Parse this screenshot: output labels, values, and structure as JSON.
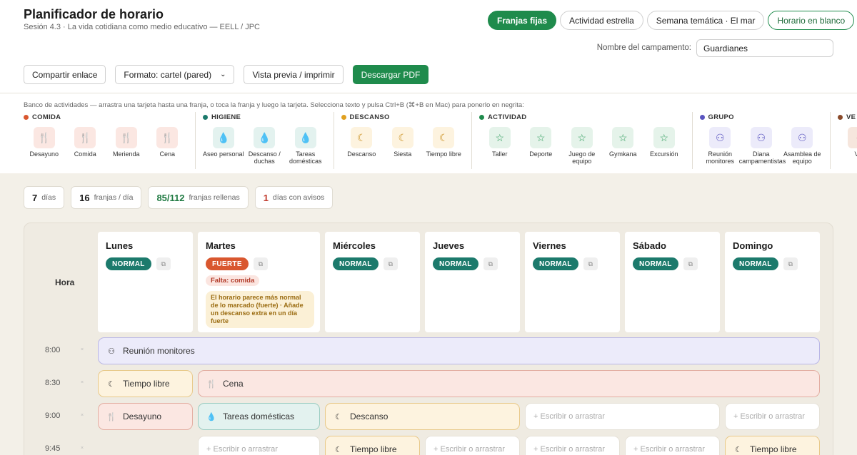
{
  "header": {
    "title": "Planificador de horario",
    "subtitle": "Sesión 4.3 · La vida cotidiana como medio educativo — EELL / JPC"
  },
  "mode_tabs": [
    {
      "label": "Franjas fijas",
      "active": true
    },
    {
      "label": "Actividad estrella",
      "active": false
    },
    {
      "label": "Semana temática · El mar",
      "active": false
    },
    {
      "label": "Horario en blanco",
      "active": false
    }
  ],
  "camp": {
    "label": "Nombre del campamento:",
    "value": "Guardianes"
  },
  "toolbar": {
    "share": "Compartir enlace",
    "format": "Formato: cartel (pared)",
    "preview": "Vista previa / imprimir",
    "download": "Descargar PDF"
  },
  "bank": {
    "hint": "Banco de actividades — arrastra una tarjeta hasta una franja, o toca la franja y luego la tarjeta. Selecciona texto y pulsa Ctrl+B (⌘+B en Mac) para ponerlo en negrita:",
    "categories": [
      {
        "name": "COMIDA",
        "color": "#d9572f",
        "bg": "#fbe7e2",
        "fg": "#c0533a",
        "icon": "utensils-icon",
        "glyph": "🍴",
        "items": [
          "Desayuno",
          "Comida",
          "Merienda",
          "Cena"
        ]
      },
      {
        "name": "HIGIENE",
        "color": "#1c7a6c",
        "bg": "#e3f2ef",
        "fg": "#2a8a7c",
        "icon": "droplet-icon",
        "glyph": "💧",
        "items": [
          "Aseo personal",
          "Descanso / duchas",
          "Tareas domésticas"
        ]
      },
      {
        "name": "DESCANSO",
        "color": "#e0a020",
        "bg": "#fdf3df",
        "fg": "#c98d1a",
        "icon": "moon-icon",
        "glyph": "☾",
        "items": [
          "Descanso",
          "Siesta",
          "Tiempo libre"
        ]
      },
      {
        "name": "ACTIVIDAD",
        "color": "#1f8b4c",
        "bg": "#e5f3ea",
        "fg": "#2a9a58",
        "icon": "star-icon",
        "glyph": "☆",
        "items": [
          "Taller",
          "Deporte",
          "Juego de equipo",
          "Gymkana",
          "Excursión"
        ]
      },
      {
        "name": "GRUPO",
        "color": "#5a55c0",
        "bg": "#ecebfa",
        "fg": "#5a55c0",
        "icon": "people-icon",
        "glyph": "⚇",
        "items": [
          "Reunión monitores",
          "Diana campamentistas",
          "Asamblea de equipo"
        ]
      },
      {
        "name": "VE",
        "color": "#8a4a2a",
        "bg": "#f6e6dd",
        "fg": "#8a4a2a",
        "icon": "partial-icon",
        "glyph": "•",
        "items": [
          "Ve"
        ]
      }
    ]
  },
  "stats": [
    {
      "num": "7",
      "label": "días",
      "tone": ""
    },
    {
      "num": "16",
      "label": "franjas / día",
      "tone": ""
    },
    {
      "num": "85/112",
      "label": "franjas rellenas",
      "tone": "green"
    },
    {
      "num": "1",
      "label": "días con avisos",
      "tone": "red"
    }
  ],
  "schedule": {
    "hora_label": "Hora",
    "days": [
      {
        "name": "Lunes",
        "badge": "NORMAL",
        "kind": "normal"
      },
      {
        "name": "Martes",
        "badge": "FUERTE",
        "kind": "fuerte",
        "missing": "Falta: comida",
        "warning": "El horario parece más normal de lo marcado (fuerte) · Añade un descanso extra en un día fuerte"
      },
      {
        "name": "Miércoles",
        "badge": "NORMAL",
        "kind": "normal"
      },
      {
        "name": "Jueves",
        "badge": "NORMAL",
        "kind": "normal"
      },
      {
        "name": "Viernes",
        "badge": "NORMAL",
        "kind": "normal"
      },
      {
        "name": "Sábado",
        "badge": "NORMAL",
        "kind": "normal"
      },
      {
        "name": "Domingo",
        "badge": "NORMAL",
        "kind": "normal"
      }
    ],
    "times": [
      "8:00",
      "8:30",
      "9:00",
      "9:45"
    ],
    "empty_label": "+ Escribir o arrastrar",
    "rows": [
      [
        {
          "label": "Reunión monitores",
          "cat": "grupo",
          "start": 0,
          "span": 7
        }
      ],
      [
        {
          "label": "Tiempo libre",
          "cat": "descanso",
          "start": 0,
          "span": 1
        },
        {
          "label": "Cena",
          "cat": "comida",
          "start": 1,
          "span": 6
        }
      ],
      [
        {
          "label": "Desayuno",
          "cat": "comida",
          "start": 0,
          "span": 1
        },
        {
          "label": "Tareas domésticas",
          "cat": "higiene",
          "start": 1,
          "span": 1
        },
        {
          "label": "Descanso",
          "cat": "descanso",
          "start": 2,
          "span": 2
        },
        {
          "label": "",
          "cat": "empty",
          "start": 4,
          "span": 2
        },
        {
          "label": "",
          "cat": "empty",
          "start": 6,
          "span": 1
        }
      ],
      [
        {
          "label": "",
          "cat": "empty",
          "start": 1,
          "span": 1
        },
        {
          "label": "Tiempo libre",
          "cat": "descanso",
          "start": 2,
          "span": 1
        },
        {
          "label": "",
          "cat": "empty",
          "start": 3,
          "span": 1
        },
        {
          "label": "",
          "cat": "empty",
          "start": 4,
          "span": 1
        },
        {
          "label": "",
          "cat": "empty",
          "start": 5,
          "span": 1
        },
        {
          "label": "Tiempo libre",
          "cat": "descanso",
          "start": 6,
          "span": 1
        }
      ]
    ]
  }
}
